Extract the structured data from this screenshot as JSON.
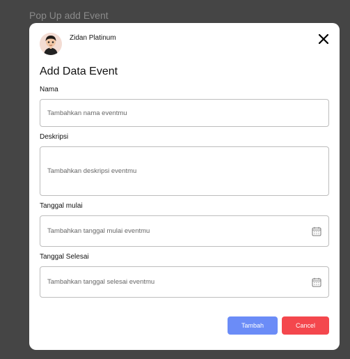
{
  "frame_label": "Pop Up add Event",
  "user": {
    "name": "Zidan Platinum"
  },
  "modal": {
    "title": "Add Data Event",
    "fields": {
      "nama": {
        "label": "Nama",
        "placeholder": "Tambahkan nama eventmu"
      },
      "deskripsi": {
        "label": "Deskripsi",
        "placeholder": "Tambahkan deskripsi eventmu"
      },
      "tanggal_mulai": {
        "label": "Tanggal mulai",
        "placeholder": "Tambahkan tanggal mulai eventmu",
        "icon": "calendar-icon"
      },
      "tanggal_selesai": {
        "label": "Tanggal Selesai",
        "placeholder": "Tambahkan tanggal selesai eventmu",
        "icon": "calendar-icon"
      }
    },
    "buttons": {
      "add": "Tambah",
      "cancel": "Cancel"
    }
  },
  "colors": {
    "primary_button": "#6b8cf7",
    "cancel_button": "#f4474d",
    "backdrop": "#454545"
  }
}
